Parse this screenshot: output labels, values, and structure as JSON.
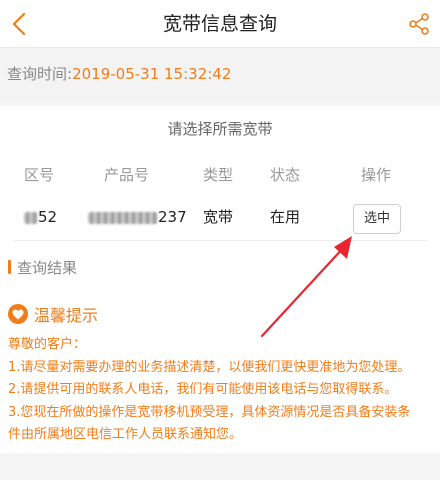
{
  "header": {
    "title": "宽带信息查询"
  },
  "query_time": {
    "label": "查询时间:",
    "value": "2019-05-31 15:32:42"
  },
  "selection": {
    "title": "请选择所需宽带",
    "columns": [
      "区号",
      "产品号",
      "类型",
      "状态",
      "操作"
    ],
    "rows": [
      {
        "area_code_visible": "52",
        "product_no_visible": "237",
        "type": "宽带",
        "status": "在用",
        "action": "选中"
      }
    ]
  },
  "result": {
    "label": "查询结果"
  },
  "tips": {
    "title": "温馨提示",
    "greeting": "尊敬的客户：",
    "lines": [
      "1.请尽量对需要办理的业务描述清楚，以便我们更快更准地为您处理。",
      "2.请提供可用的联系人电话，我们有可能使用该电话与您取得联系。",
      "3.您现在所做的操作是宽带移机预受理，具体资源情况是否具备安装条",
      "件由所属地区电信工作人员联系通知您。"
    ]
  },
  "colors": {
    "accent": "#f07d18",
    "annotation_arrow": "#e8262f"
  },
  "icons": {
    "back": "chevron-left-icon",
    "share": "share-icon",
    "tips": "heart-icon"
  }
}
